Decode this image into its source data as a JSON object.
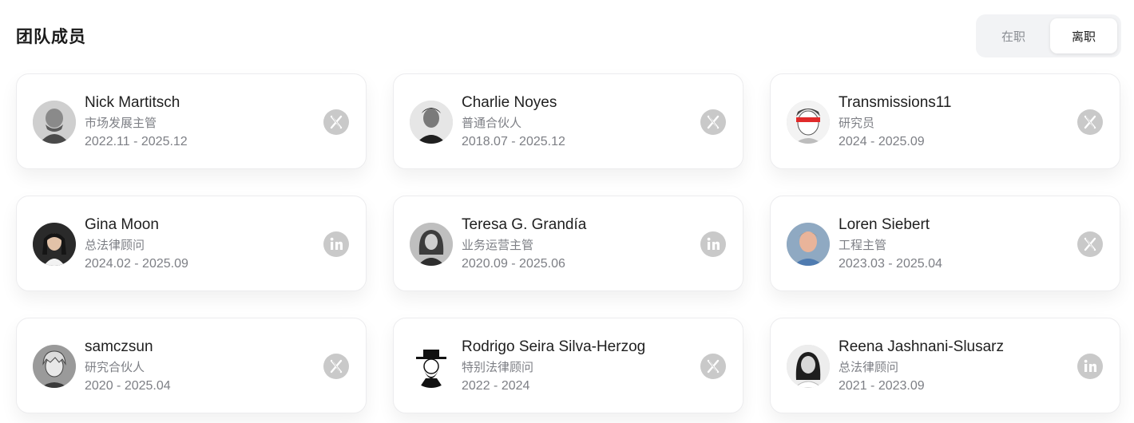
{
  "header": {
    "title": "团队成员"
  },
  "status_toggle": {
    "options": [
      {
        "label": "在职",
        "active": false
      },
      {
        "label": "离职",
        "active": true
      }
    ]
  },
  "colors": {
    "social_icon_bg": "#c9c9c9",
    "card_border": "#ececee",
    "muted_text": "#7d7f85"
  },
  "members": [
    {
      "name": "Nick Martitsch",
      "role": "市场发展主管",
      "dates": "2022.11 - 2025.12",
      "social": "x-icon"
    },
    {
      "name": "Charlie Noyes",
      "role": "普通合伙人",
      "dates": "2018.07 - 2025.12",
      "social": "x-icon"
    },
    {
      "name": "Transmissions11",
      "role": "研究员",
      "dates": "2024 - 2025.09",
      "social": "x-icon"
    },
    {
      "name": "Gina Moon",
      "role": "总法律顾问",
      "dates": "2024.02 - 2025.09",
      "social": "linkedin-icon"
    },
    {
      "name": "Teresa G. Grandía",
      "role": "业务运营主管",
      "dates": "2020.09 - 2025.06",
      "social": "linkedin-icon"
    },
    {
      "name": "Loren Siebert",
      "role": "工程主管",
      "dates": "2023.03 - 2025.04",
      "social": "x-icon"
    },
    {
      "name": "samczsun",
      "role": "研究合伙人",
      "dates": "2020 - 2025.04",
      "social": "x-icon"
    },
    {
      "name": "Rodrigo Seira Silva-Herzog",
      "role": "特别法律顾问",
      "dates": "2022 - 2024",
      "social": "x-icon"
    },
    {
      "name": "Reena Jashnani-Slusarz",
      "role": "总法律顾问",
      "dates": "2021 - 2023.09",
      "social": "linkedin-icon"
    }
  ]
}
